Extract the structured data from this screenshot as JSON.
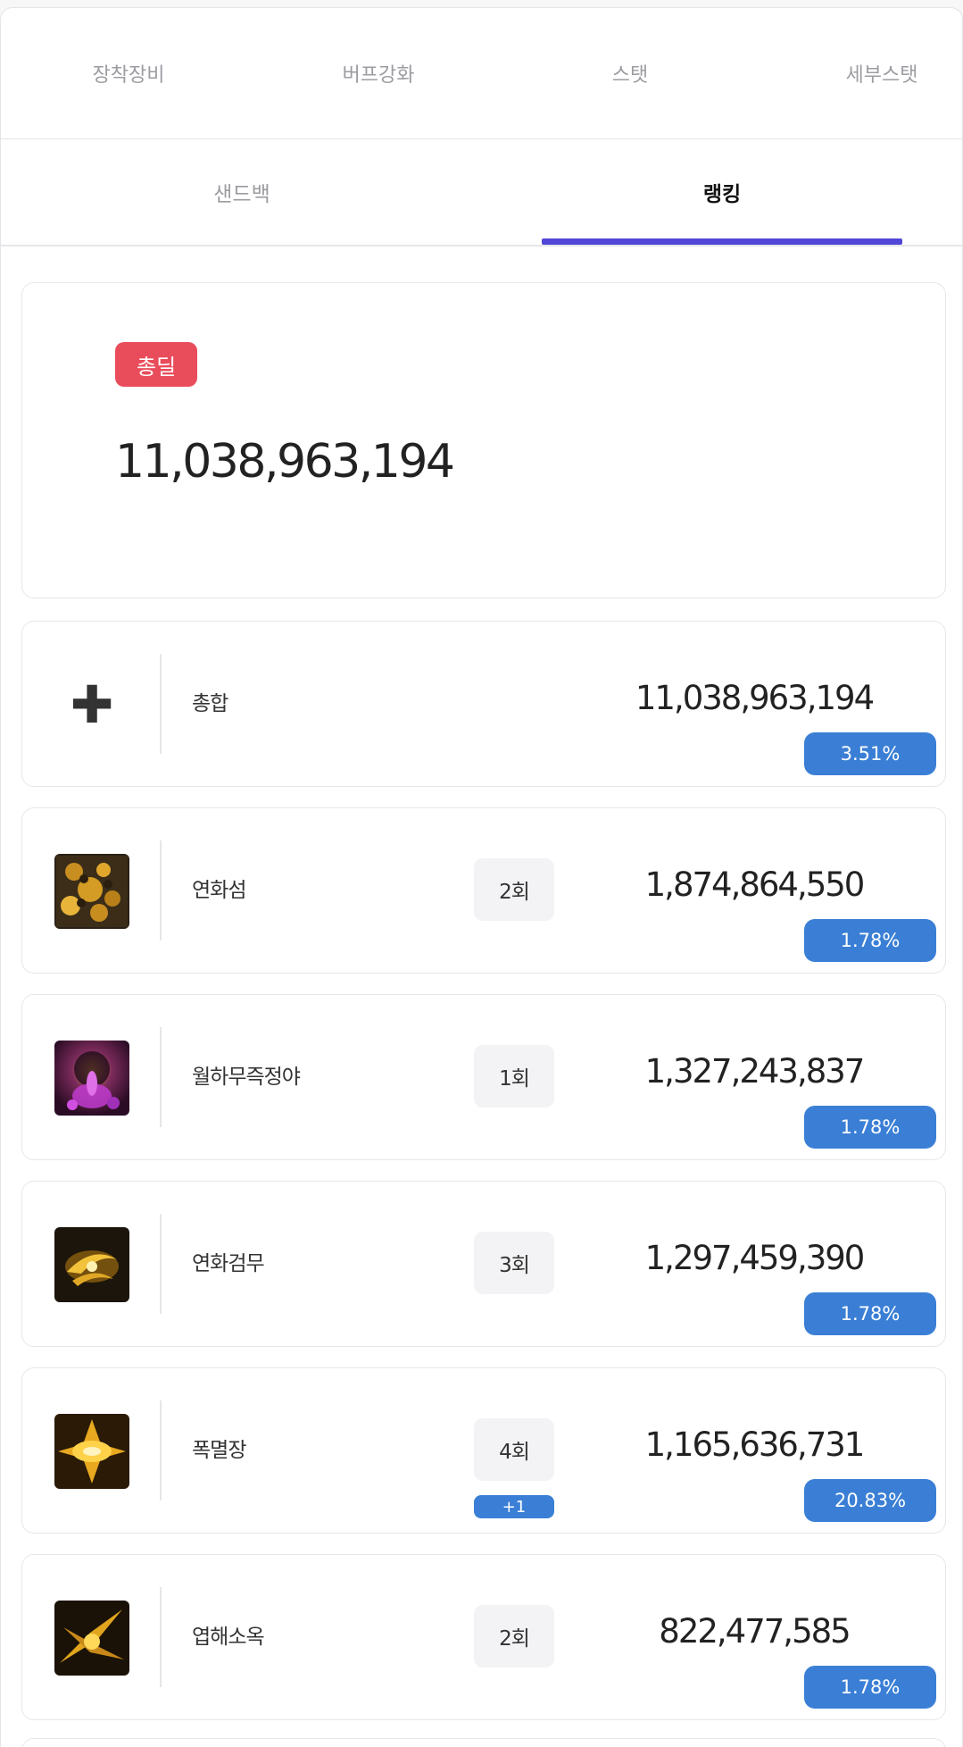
{
  "top_tabs": [
    "장착장비",
    "버프강화",
    "스탯",
    "세부스탯"
  ],
  "sub_tabs": {
    "sandbag": "샌드백",
    "ranking": "랭킹",
    "active": "랭킹"
  },
  "total": {
    "badge": "총딜",
    "value": "11,038,963,194"
  },
  "rows": [
    {
      "name": "총합",
      "count": "",
      "plus": "",
      "damage": "11,038,963,194",
      "percent": "3.51%",
      "icon": "plus-icon"
    },
    {
      "name": "연화섬",
      "count": "2회",
      "plus": "",
      "damage": "1,874,864,550",
      "percent": "1.78%",
      "icon": "skill-icon-yeonhwaseom"
    },
    {
      "name": "월하무즉정야",
      "count": "1회",
      "plus": "",
      "damage": "1,327,243,837",
      "percent": "1.78%",
      "icon": "skill-icon-wolhamujeukjeongya"
    },
    {
      "name": "연화검무",
      "count": "3회",
      "plus": "",
      "damage": "1,297,459,390",
      "percent": "1.78%",
      "icon": "skill-icon-yeonhwageommu"
    },
    {
      "name": "폭멸장",
      "count": "4회",
      "plus": "+1",
      "damage": "1,165,636,731",
      "percent": "20.83%",
      "icon": "skill-icon-pokmyeoljang"
    },
    {
      "name": "엽해소옥",
      "count": "2회",
      "plus": "",
      "damage": "822,477,585",
      "percent": "1.78%",
      "icon": "skill-icon-yeophaesook"
    }
  ],
  "colors": {
    "accent": "#5146d6",
    "badge_red": "#e94c5b",
    "percent_blue": "#3a7fd5"
  }
}
